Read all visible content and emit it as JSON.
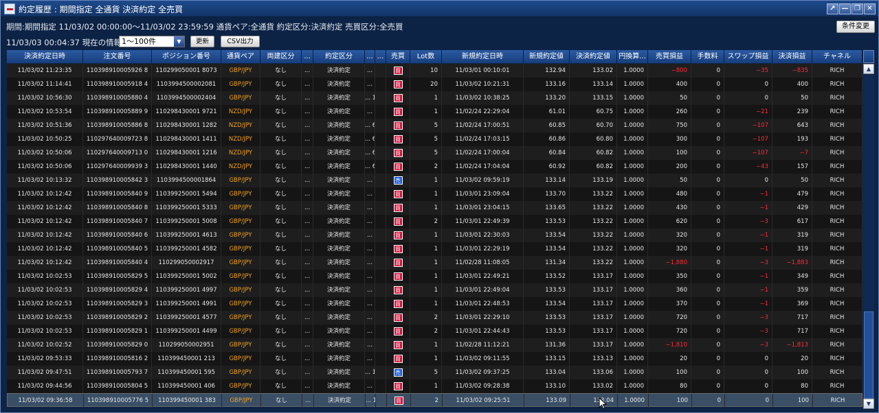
{
  "window": {
    "title": "約定履歴 : 期間指定 全通貨 決済約定 全売買",
    "buttons": [
      "↗",
      "—",
      "❐",
      "✕"
    ]
  },
  "filters": {
    "summary": "期間:期間指定 11/03/02 00:00:00～11/03/02 23:59:59 通貨ペア:全通貨 約定区分:決済約定 売買区分:全売買",
    "condition_button": "条件変更",
    "now_info": "11/03/03 00:04:37 現在の情報",
    "range_select": "1〜100件",
    "refresh_button": "更新",
    "csv_button": "CSV出力"
  },
  "table": {
    "columns": [
      "決済約定日時",
      "注文番号",
      "ポジション番号",
      "通貨ペア",
      "両建区分",
      "...",
      "約定区分",
      "...",
      "...",
      "売買",
      "Lot数",
      "新規約定日時",
      "新規約定値",
      "決済約定値",
      "円換算...",
      "売買損益",
      "手数料",
      "スワップ損益",
      "決済損益",
      "チャネル"
    ],
    "rows": [
      {
        "dt": "11/03/02 11:23:35",
        "order": "110398910005926 8",
        "pos": "110299050001 8073",
        "pair": "GBP/JPY",
        "hedge": "なし",
        "x1": "...",
        "kind": "決済約定",
        "x2": "...",
        "x3": "",
        "side": "買",
        "lot": "10",
        "new_dt": "11/03/01 00:10:01",
        "new_px": "132.94",
        "close_px": "133.02",
        "conv": "1.0000",
        "pl": "−800",
        "fee": "0",
        "swap": "−35",
        "net": "−835",
        "ch": "RICH",
        "pl_neg": true,
        "swap_neg": true,
        "net_neg": true
      },
      {
        "dt": "11/03/02 11:14:41",
        "order": "110398910005918 4",
        "pos": "1103994500002081",
        "pair": "GBP/JPY",
        "hedge": "なし",
        "x1": "...",
        "kind": "決済約定",
        "x2": "...",
        "x3": "",
        "side": "買",
        "lot": "20",
        "new_dt": "11/03/02 10:21:31",
        "new_px": "133.16",
        "close_px": "133.14",
        "conv": "1.0000",
        "pl": "400",
        "fee": "0",
        "swap": "0",
        "net": "400",
        "ch": "RICH",
        "pl_neg": false,
        "swap_neg": false,
        "net_neg": false
      },
      {
        "dt": "11/03/02 10:56:30",
        "order": "110398910005880 4",
        "pos": "1103994500002404",
        "pair": "GBP/JPY",
        "hedge": "なし",
        "x1": "...",
        "kind": "決済約定",
        "x2": "... 1 ...",
        "x3": "",
        "side": "買",
        "lot": "1",
        "new_dt": "11/03/02 10:38:25",
        "new_px": "133.20",
        "close_px": "133.15",
        "conv": "1.0000",
        "pl": "50",
        "fee": "0",
        "swap": "0",
        "net": "50",
        "ch": "RICH",
        "pl_neg": false,
        "swap_neg": false,
        "net_neg": false
      },
      {
        "dt": "11/03/02 10:53:54",
        "order": "110398910005889 9",
        "pos": "110298430001 9721",
        "pair": "NZD/JPY",
        "hedge": "なし",
        "x1": "...",
        "kind": "決済約定",
        "x2": "...",
        "x3": "",
        "side": "買",
        "lot": "1",
        "new_dt": "11/02/24 22:29:04",
        "new_px": "61.01",
        "close_px": "60.75",
        "conv": "1.0000",
        "pl": "260",
        "fee": "0",
        "swap": "−21",
        "net": "239",
        "ch": "RICH",
        "pl_neg": false,
        "swap_neg": true,
        "net_neg": false
      },
      {
        "dt": "11/03/02 10:51:36",
        "order": "110398910005886 8",
        "pos": "110298430001 1282",
        "pair": "NZD/JPY",
        "hedge": "なし",
        "x1": "...",
        "kind": "決済約定",
        "x2": "... 6 ...",
        "x3": "",
        "side": "買",
        "lot": "5",
        "new_dt": "11/02/24 17:00:51",
        "new_px": "60.85",
        "close_px": "60.70",
        "conv": "1.0000",
        "pl": "750",
        "fee": "0",
        "swap": "−107",
        "net": "643",
        "ch": "RICH",
        "pl_neg": false,
        "swap_neg": true,
        "net_neg": false
      },
      {
        "dt": "11/03/02 10:50:25",
        "order": "110297640009723 8",
        "pos": "110298430001 1411",
        "pair": "NZD/JPY",
        "hedge": "なし",
        "x1": "...",
        "kind": "決済約定",
        "x2": "... 6 ...",
        "x3": "",
        "side": "買",
        "lot": "5",
        "new_dt": "11/02/24 17:03:15",
        "new_px": "60.86",
        "close_px": "60.80",
        "conv": "1.0000",
        "pl": "300",
        "fee": "0",
        "swap": "−107",
        "net": "193",
        "ch": "RICH",
        "pl_neg": false,
        "swap_neg": true,
        "net_neg": false
      },
      {
        "dt": "11/03/02 10:50:06",
        "order": "110297640009713 0",
        "pos": "110298430001 1216",
        "pair": "NZD/JPY",
        "hedge": "なし",
        "x1": "...",
        "kind": "決済約定",
        "x2": "... 6 ...",
        "x3": "",
        "side": "買",
        "lot": "5",
        "new_dt": "11/02/24 17:00:04",
        "new_px": "60.84",
        "close_px": "60.82",
        "conv": "1.0000",
        "pl": "100",
        "fee": "0",
        "swap": "−107",
        "net": "−7",
        "ch": "RICH",
        "pl_neg": false,
        "swap_neg": true,
        "net_neg": true
      },
      {
        "dt": "11/03/02 10:50:06",
        "order": "110297640009939 3",
        "pos": "110298430001 1440",
        "pair": "NZD/JPY",
        "hedge": "なし",
        "x1": "...",
        "kind": "決済約定",
        "x2": "... 6 ...",
        "x3": "",
        "side": "買",
        "lot": "2",
        "new_dt": "11/02/24 17:04:04",
        "new_px": "60.92",
        "close_px": "60.82",
        "conv": "1.0000",
        "pl": "200",
        "fee": "0",
        "swap": "−43",
        "net": "157",
        "ch": "RICH",
        "pl_neg": false,
        "swap_neg": true,
        "net_neg": false
      },
      {
        "dt": "11/03/02 10:13:32",
        "order": "110398910005842 3",
        "pos": "1103994500001864",
        "pair": "GBP/JPY",
        "hedge": "なし",
        "x1": "...",
        "kind": "決済約定",
        "x2": "...",
        "x3": "",
        "side": "売",
        "lot": "1",
        "new_dt": "11/03/02 09:59:19",
        "new_px": "133.14",
        "close_px": "133.19",
        "conv": "1.0000",
        "pl": "50",
        "fee": "0",
        "swap": "0",
        "net": "50",
        "ch": "RICH",
        "pl_neg": false,
        "swap_neg": false,
        "net_neg": false
      },
      {
        "dt": "11/03/02 10:12:42",
        "order": "110398910005840 9",
        "pos": "110399250001 5494",
        "pair": "GBP/JPY",
        "hedge": "なし",
        "x1": "...",
        "kind": "決済約定",
        "x2": "...",
        "x3": "",
        "side": "買",
        "lot": "1",
        "new_dt": "11/03/01 23:09:04",
        "new_px": "133.70",
        "close_px": "133.22",
        "conv": "1.0000",
        "pl": "480",
        "fee": "0",
        "swap": "−1",
        "net": "479",
        "ch": "RICH",
        "pl_neg": false,
        "swap_neg": true,
        "net_neg": false
      },
      {
        "dt": "11/03/02 10:12:42",
        "order": "110398910005840 8",
        "pos": "110399250001 5333",
        "pair": "GBP/JPY",
        "hedge": "なし",
        "x1": "...",
        "kind": "決済約定",
        "x2": "...",
        "x3": "",
        "side": "買",
        "lot": "1",
        "new_dt": "11/03/01 23:04:15",
        "new_px": "133.65",
        "close_px": "133.22",
        "conv": "1.0000",
        "pl": "430",
        "fee": "0",
        "swap": "−1",
        "net": "429",
        "ch": "RICH",
        "pl_neg": false,
        "swap_neg": true,
        "net_neg": false
      },
      {
        "dt": "11/03/02 10:12:42",
        "order": "110398910005840 7",
        "pos": "110399250001 5008",
        "pair": "GBP/JPY",
        "hedge": "なし",
        "x1": "...",
        "kind": "決済約定",
        "x2": "...",
        "x3": "",
        "side": "買",
        "lot": "2",
        "new_dt": "11/03/01 22:49:39",
        "new_px": "133.53",
        "close_px": "133.22",
        "conv": "1.0000",
        "pl": "620",
        "fee": "0",
        "swap": "−3",
        "net": "617",
        "ch": "RICH",
        "pl_neg": false,
        "swap_neg": true,
        "net_neg": false
      },
      {
        "dt": "11/03/02 10:12:42",
        "order": "110398910005840 6",
        "pos": "110399250001 4613",
        "pair": "GBP/JPY",
        "hedge": "なし",
        "x1": "...",
        "kind": "決済約定",
        "x2": "...",
        "x3": "",
        "side": "買",
        "lot": "1",
        "new_dt": "11/03/01 22:30:03",
        "new_px": "133.54",
        "close_px": "133.22",
        "conv": "1.0000",
        "pl": "320",
        "fee": "0",
        "swap": "−1",
        "net": "319",
        "ch": "RICH",
        "pl_neg": false,
        "swap_neg": true,
        "net_neg": false
      },
      {
        "dt": "11/03/02 10:12:42",
        "order": "110398910005840 5",
        "pos": "110399250001 4582",
        "pair": "GBP/JPY",
        "hedge": "なし",
        "x1": "...",
        "kind": "決済約定",
        "x2": "...",
        "x3": "",
        "side": "買",
        "lot": "1",
        "new_dt": "11/03/01 22:29:19",
        "new_px": "133.54",
        "close_px": "133.22",
        "conv": "1.0000",
        "pl": "320",
        "fee": "0",
        "swap": "−1",
        "net": "319",
        "ch": "RICH",
        "pl_neg": false,
        "swap_neg": true,
        "net_neg": false
      },
      {
        "dt": "11/03/02 10:12:42",
        "order": "110398910005840 4",
        "pos": "110299050002917",
        "pair": "GBP/JPY",
        "hedge": "なし",
        "x1": "...",
        "kind": "決済約定",
        "x2": "...",
        "x3": "",
        "side": "買",
        "lot": "1",
        "new_dt": "11/02/28 11:08:05",
        "new_px": "131.34",
        "close_px": "133.22",
        "conv": "1.0000",
        "pl": "−1,880",
        "fee": "0",
        "swap": "−3",
        "net": "−1,883",
        "ch": "RICH",
        "pl_neg": true,
        "swap_neg": true,
        "net_neg": true
      },
      {
        "dt": "11/03/02 10:02:53",
        "order": "110398910005829 5",
        "pos": "110399250001 5002",
        "pair": "GBP/JPY",
        "hedge": "なし",
        "x1": "...",
        "kind": "決済約定",
        "x2": "...",
        "x3": "",
        "side": "買",
        "lot": "1",
        "new_dt": "11/03/01 22:49:21",
        "new_px": "133.52",
        "close_px": "133.17",
        "conv": "1.0000",
        "pl": "350",
        "fee": "0",
        "swap": "−1",
        "net": "349",
        "ch": "RICH",
        "pl_neg": false,
        "swap_neg": true,
        "net_neg": false
      },
      {
        "dt": "11/03/02 10:02:53",
        "order": "110398910005829 4",
        "pos": "110399250001 4997",
        "pair": "GBP/JPY",
        "hedge": "なし",
        "x1": "...",
        "kind": "決済約定",
        "x2": "...",
        "x3": "",
        "side": "買",
        "lot": "1",
        "new_dt": "11/03/01 22:49:04",
        "new_px": "133.53",
        "close_px": "133.17",
        "conv": "1.0000",
        "pl": "360",
        "fee": "0",
        "swap": "−1",
        "net": "359",
        "ch": "RICH",
        "pl_neg": false,
        "swap_neg": true,
        "net_neg": false
      },
      {
        "dt": "11/03/02 10:02:53",
        "order": "110398910005829 3",
        "pos": "110399250001 4991",
        "pair": "GBP/JPY",
        "hedge": "なし",
        "x1": "...",
        "kind": "決済約定",
        "x2": "...",
        "x3": "",
        "side": "買",
        "lot": "1",
        "new_dt": "11/03/01 22:48:53",
        "new_px": "133.54",
        "close_px": "133.17",
        "conv": "1.0000",
        "pl": "370",
        "fee": "0",
        "swap": "−1",
        "net": "369",
        "ch": "RICH",
        "pl_neg": false,
        "swap_neg": true,
        "net_neg": false
      },
      {
        "dt": "11/03/02 10:02:53",
        "order": "110398910005829 2",
        "pos": "110399250001 4577",
        "pair": "GBP/JPY",
        "hedge": "なし",
        "x1": "...",
        "kind": "決済約定",
        "x2": "...",
        "x3": "",
        "side": "買",
        "lot": "2",
        "new_dt": "11/03/01 22:29:10",
        "new_px": "133.53",
        "close_px": "133.17",
        "conv": "1.0000",
        "pl": "720",
        "fee": "0",
        "swap": "−3",
        "net": "717",
        "ch": "RICH",
        "pl_neg": false,
        "swap_neg": true,
        "net_neg": false
      },
      {
        "dt": "11/03/02 10:02:53",
        "order": "110398910005829 1",
        "pos": "110399250001 4499",
        "pair": "GBP/JPY",
        "hedge": "なし",
        "x1": "...",
        "kind": "決済約定",
        "x2": "...",
        "x3": "",
        "side": "買",
        "lot": "2",
        "new_dt": "11/03/01 22:44:43",
        "new_px": "133.53",
        "close_px": "133.17",
        "conv": "1.0000",
        "pl": "720",
        "fee": "0",
        "swap": "−3",
        "net": "717",
        "ch": "RICH",
        "pl_neg": false,
        "swap_neg": true,
        "net_neg": false
      },
      {
        "dt": "11/03/02 10:02:52",
        "order": "110398910005829 0",
        "pos": "110299050002951",
        "pair": "GBP/JPY",
        "hedge": "なし",
        "x1": "...",
        "kind": "決済約定",
        "x2": "...",
        "x3": "",
        "side": "買",
        "lot": "1",
        "new_dt": "11/02/28 11:12:21",
        "new_px": "131.36",
        "close_px": "133.17",
        "conv": "1.0000",
        "pl": "−1,810",
        "fee": "0",
        "swap": "−3",
        "net": "−1,813",
        "ch": "RICH",
        "pl_neg": true,
        "swap_neg": true,
        "net_neg": true
      },
      {
        "dt": "11/03/02 09:53:33",
        "order": "110398910005816 2",
        "pos": "110399450001 213",
        "pair": "GBP/JPY",
        "hedge": "なし",
        "x1": "...",
        "kind": "決済約定",
        "x2": "...",
        "x3": "",
        "side": "買",
        "lot": "1",
        "new_dt": "11/03/02 09:11:55",
        "new_px": "133.15",
        "close_px": "133.13",
        "conv": "1.0000",
        "pl": "20",
        "fee": "0",
        "swap": "0",
        "net": "20",
        "ch": "RICH",
        "pl_neg": false,
        "swap_neg": false,
        "net_neg": false
      },
      {
        "dt": "11/03/02 09:47:51",
        "order": "110398910005793 7",
        "pos": "110399450001 595",
        "pair": "GBP/JPY",
        "hedge": "なし",
        "x1": "...",
        "kind": "決済約定",
        "x2": "... 1 ...",
        "x3": "",
        "side": "売",
        "lot": "5",
        "new_dt": "11/03/02 09:37:25",
        "new_px": "133.04",
        "close_px": "133.06",
        "conv": "1.0000",
        "pl": "100",
        "fee": "0",
        "swap": "0",
        "net": "100",
        "ch": "RICH",
        "pl_neg": false,
        "swap_neg": false,
        "net_neg": false
      },
      {
        "dt": "11/03/02 09:44:56",
        "order": "110398910005804 5",
        "pos": "110399450001 406",
        "pair": "GBP/JPY",
        "hedge": "なし",
        "x1": "...",
        "kind": "決済約定",
        "x2": "...",
        "x3": "",
        "side": "買",
        "lot": "1",
        "new_dt": "11/03/02 09:28:38",
        "new_px": "133.10",
        "close_px": "133.02",
        "conv": "1.0000",
        "pl": "80",
        "fee": "0",
        "swap": "0",
        "net": "80",
        "ch": "RICH",
        "pl_neg": false,
        "swap_neg": false,
        "net_neg": false
      },
      {
        "dt": "11/03/02 09:36:58",
        "order": "110398910005776 5",
        "pos": "110399450001 383",
        "pair": "GBP/JPY",
        "hedge": "なし",
        "x1": "...",
        "kind": "決済約定",
        "x2": "... 1 ...",
        "x3": "",
        "side": "買",
        "lot": "2",
        "new_dt": "11/03/02 09:25:51",
        "new_px": "133.09",
        "close_px": "133.04",
        "conv": "1.0000",
        "pl": "100",
        "fee": "0",
        "swap": "0",
        "net": "100",
        "ch": "RICH",
        "pl_neg": false,
        "swap_neg": false,
        "net_neg": false
      }
    ]
  }
}
